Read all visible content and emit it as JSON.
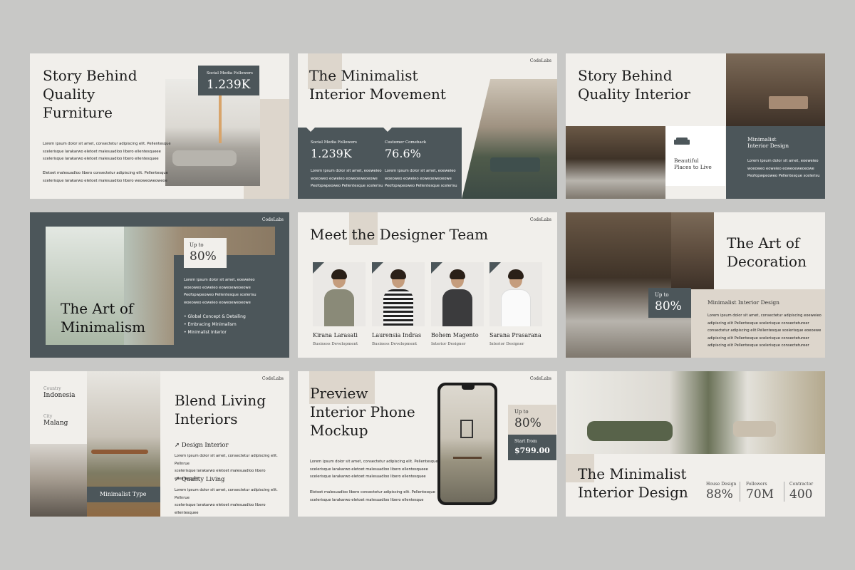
{
  "brand": "CodeLabs",
  "lorem_a": "Lorem ipsum dolor sit amet, consectetur adipiscing elit. Pellentesque\nscelerisque larakarwo eletoet malesuadloo libero ellentesqueee\nscelerisque larakarwo eletoet malesuadloo libero ellentesquee",
  "lorem_b": "Eletoet malesuadloo libero consectetur adipiscing elit. Pellentesque\nscelerisque larakarwo eletoet malesuadloo libero ellentesque",
  "lorem_c": "Lorem ipsum dolor sit amet, eoeweieo\nwoeoweo eoweieo eoweoeweoeowe\nPeofopwpeoweo Pellentesque scelerisu",
  "slide1": {
    "title": "Story Behind\nQuality\nFurniture",
    "stat_label": "Social Media Followers",
    "stat_value": "1.239K",
    "body_b": "Eletoet malesuadloo libero consectetur adipiscing elit. Pellentesque\nscelerisque larakarwo eletoet malesuadloo libero  weoweoweoweoe"
  },
  "slide2": {
    "title": "The Minimalist\nInterior Movement",
    "stat1_label": "Social Media Followers",
    "stat1_value": "1.239K",
    "stat2_label": "Customer Comeback",
    "stat2_value": "76.6%"
  },
  "slide3": {
    "title": "Story Behind\nQuality Interior",
    "card_label": "Beautiful\nPlaces to Live",
    "icon": "sofa-icon",
    "side_title": "Minimalist\nInterior Design",
    "side_body": "Lorem ipsum dolor sit amet, eoeweieo\nwoeoweo eoweieo eoweoeweoeowe\nPeofopwpeoweo Pellentesque scelerisu"
  },
  "slide4": {
    "title": "The Art of\nMinimalism",
    "upto": "Up to",
    "value": "80%",
    "body": "Lorem ipsum dolor sit amet, eoeweieo\nwoeoweo eoweieo eoweoeweoeowe\nPeofopwpeoweo Pellentesque scelerisu\nwoeoweo eoweieo eoweoeweoeowe",
    "bullets": [
      "Global Concept & Detailing",
      "Embracing Minimalism",
      "Minimalist Interior"
    ]
  },
  "slide5": {
    "title": "Meet the Designer Team",
    "members": [
      {
        "name": "Kirana Larasati",
        "role": "Business Development"
      },
      {
        "name": "Laurensia Indras",
        "role": "Business Development"
      },
      {
        "name": "Bohem Magento",
        "role": "Interior Designer"
      },
      {
        "name": "Sarana Prasarana",
        "role": "Interior Designer"
      }
    ]
  },
  "slide6": {
    "title": "The Art of\nDecoration",
    "upto": "Up to",
    "value": "80%",
    "side_title": "Minimalist Interior Design",
    "body": "Lorem ipsum dolor sit amet, consectetur adipiscing eoeweieo\nadipiscing elit Pellentesque scelerisque consectetureer\nconsectetur adipiscing elit Pellentesque scelerisque eoeoewe\nadipiscing elit Pellentesque scelerisque consectetureer\nadipiscing elit Pellentesque scelerisque consectetureer"
  },
  "slide7": {
    "title": "Blend Living\nInteriors",
    "country_label": "Country",
    "country": "Indonesia",
    "city_label": "City",
    "city": "Malang",
    "tag": "Minimalist Type",
    "item1": "Design Interior",
    "item2": "Quality Living",
    "item_body": "Lorem ipsum dolor sit amet, consectetur adipiscing elit. Pellnrue\nscelerisque larakarwo eletoet malesuadloo libero ellentesquee"
  },
  "slide8": {
    "title": "Preview\nInterior Phone\nMockup",
    "upto": "Up to",
    "value": "80%",
    "start_label": "Start from",
    "price": "$799.00"
  },
  "slide9": {
    "title": "The Minimalist\nInterior Design",
    "stats": [
      {
        "label": "House Design",
        "value": "88%"
      },
      {
        "label": "Followers",
        "value": "70M"
      },
      {
        "label": "Contractor",
        "value": "400"
      }
    ]
  },
  "colors": {
    "slate": "#4c565a",
    "beige": "#ddd6cc",
    "paper": "#f1efeb",
    "background": "#c8c8c6"
  }
}
